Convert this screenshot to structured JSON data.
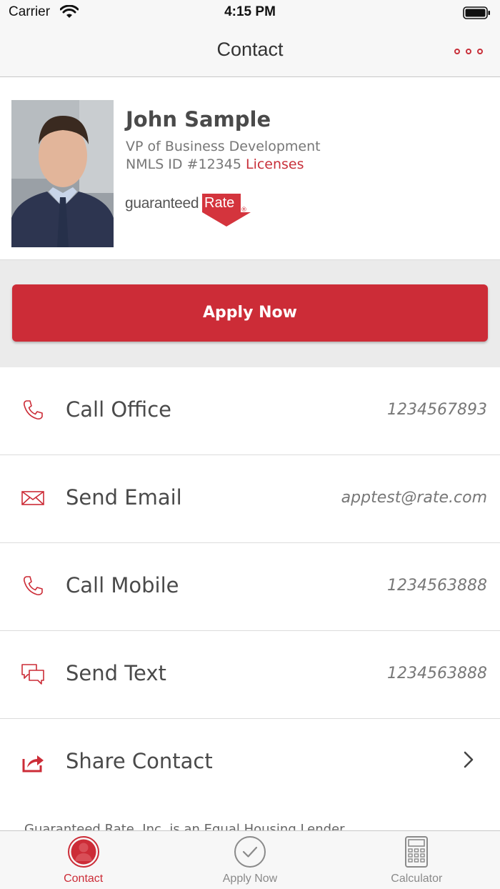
{
  "status_bar": {
    "carrier": "Carrier",
    "time": "4:15 PM"
  },
  "nav": {
    "title": "Contact",
    "more_icon": "more-icon"
  },
  "profile": {
    "name": "John Sample",
    "title": "VP of Business Development",
    "nmls": "NMLS ID #12345",
    "licenses_label": "Licenses",
    "brand": {
      "text": "guaranteed",
      "highlight": "Rate",
      "reg": "®"
    }
  },
  "apply_button": {
    "label": "Apply Now"
  },
  "contacts": [
    {
      "label": "Call Office",
      "value": "1234567893",
      "icon": "phone-icon"
    },
    {
      "label": "Send Email",
      "value": "apptest@rate.com",
      "icon": "envelope-icon"
    },
    {
      "label": "Call Mobile",
      "value": "1234563888",
      "icon": "phone-icon"
    },
    {
      "label": "Send Text",
      "value": "1234563888",
      "icon": "chat-bubbles-icon"
    },
    {
      "label": "Share Contact",
      "value": "",
      "icon": "share-icon"
    }
  ],
  "footer": {
    "text": "Guaranteed Rate, Inc. is an Equal Housing Lender"
  },
  "tabs": [
    {
      "label": "Contact",
      "icon": "person-icon",
      "active": true
    },
    {
      "label": "Apply Now",
      "icon": "checkmark-circle-icon",
      "active": false
    },
    {
      "label": "Calculator",
      "icon": "calculator-icon",
      "active": false
    }
  ],
  "colors": {
    "accent": "#cc2c37",
    "text": "#4a4a4a",
    "muted": "#777777",
    "bar": "#f7f7f7"
  }
}
